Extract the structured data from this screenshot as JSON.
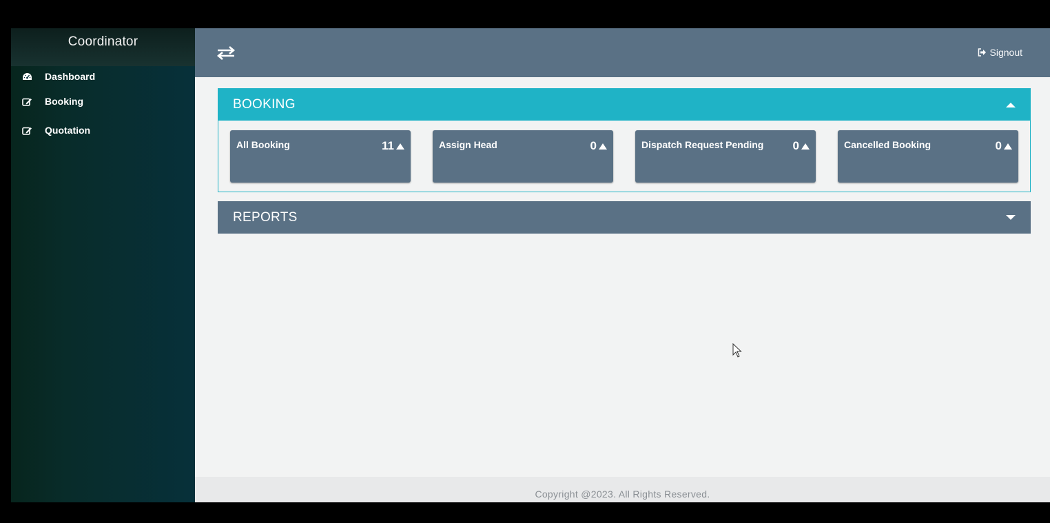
{
  "sidebar": {
    "brand": "Coordinator",
    "items": [
      {
        "label": "Dashboard",
        "icon": "dashboard-icon"
      },
      {
        "label": "Booking",
        "icon": "edit-icon"
      },
      {
        "label": "Quotation",
        "icon": "edit-icon"
      }
    ]
  },
  "topbar": {
    "toggle_icon": "swap-arrows-icon",
    "signout_label": "Signout",
    "signout_icon": "signout-icon"
  },
  "booking_panel": {
    "title": "BOOKING",
    "state": "expanded",
    "cards": [
      {
        "label": "All Booking",
        "value": "11"
      },
      {
        "label": "Assign Head",
        "value": "0"
      },
      {
        "label": "Dispatch Request Pending",
        "value": "0"
      },
      {
        "label": "Cancelled Booking",
        "value": "0"
      }
    ]
  },
  "reports_panel": {
    "title": "REPORTS",
    "state": "collapsed"
  },
  "footer": {
    "text": "Copyright @2023. All Rights Reserved."
  },
  "colors": {
    "sidebar": "#07303a",
    "topbar": "#5a7185",
    "accent": "#1fb3c6",
    "card": "#5a7185",
    "content_bg": "#f2f3f3"
  }
}
